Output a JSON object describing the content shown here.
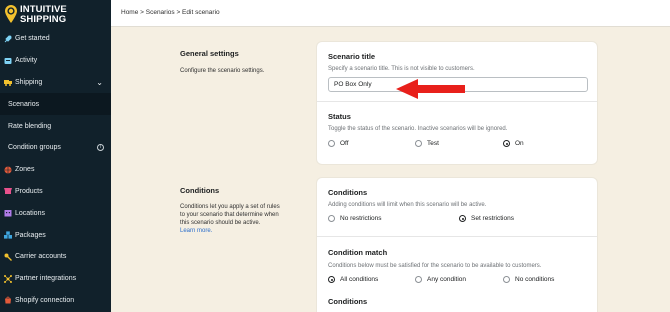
{
  "brand": {
    "logo_text_line1": "INTUITIVE",
    "logo_text_line2": "SHIPPING",
    "accent": "#f2c12e",
    "sidebar_bg": "#11212b"
  },
  "sidebar": {
    "items": [
      {
        "label": "Get started",
        "icon": "rocket-icon"
      },
      {
        "label": "Activity",
        "icon": "activity-icon"
      },
      {
        "label": "Shipping",
        "icon": "truck-icon",
        "expanded": true
      },
      {
        "label": "Scenarios",
        "active": true
      },
      {
        "label": "Rate blending"
      },
      {
        "label": "Condition groups",
        "icon": "info-icon"
      },
      {
        "label": "Zones",
        "icon": "globe-icon"
      },
      {
        "label": "Products",
        "icon": "tag-icon"
      },
      {
        "label": "Locations",
        "icon": "building-icon"
      },
      {
        "label": "Packages",
        "icon": "boxes-icon"
      },
      {
        "label": "Carrier accounts",
        "icon": "key-icon"
      },
      {
        "label": "Partner integrations",
        "icon": "network-icon"
      },
      {
        "label": "Shopify connection",
        "icon": "shopify-bag-icon"
      }
    ]
  },
  "breadcrumb": "Home > Scenarios > Edit scenario",
  "general": {
    "title": "General settings",
    "description": "Configure the scenario settings."
  },
  "scenario_title": {
    "label": "Scenario title",
    "help": "Specify a scenario title. This is not visible to customers.",
    "value": "PO Box Only"
  },
  "status": {
    "label": "Status",
    "help": "Toggle the status of the scenario. Inactive scenarios will be ignored.",
    "options": [
      "Off",
      "Test",
      "On"
    ],
    "selected": "On"
  },
  "conditions_section": {
    "title": "Conditions",
    "description_line1": "Conditions let you apply a set of rules",
    "description_line2": "to your scenario that determine when",
    "description_line3": "this scenario should be active.",
    "learn_more": "Learn more."
  },
  "conditions_card": {
    "label": "Conditions",
    "help": "Adding conditions will limit when this scenario will be active.",
    "options": [
      "No restrictions",
      "Set restrictions"
    ],
    "selected": "Set restrictions"
  },
  "condition_match": {
    "label": "Condition match",
    "help": "Conditions below must be satisfied for the scenario to be available to customers.",
    "options": [
      "All conditions",
      "Any condition",
      "No conditions"
    ],
    "selected": "All conditions"
  },
  "conditions_footer_label": "Conditions"
}
